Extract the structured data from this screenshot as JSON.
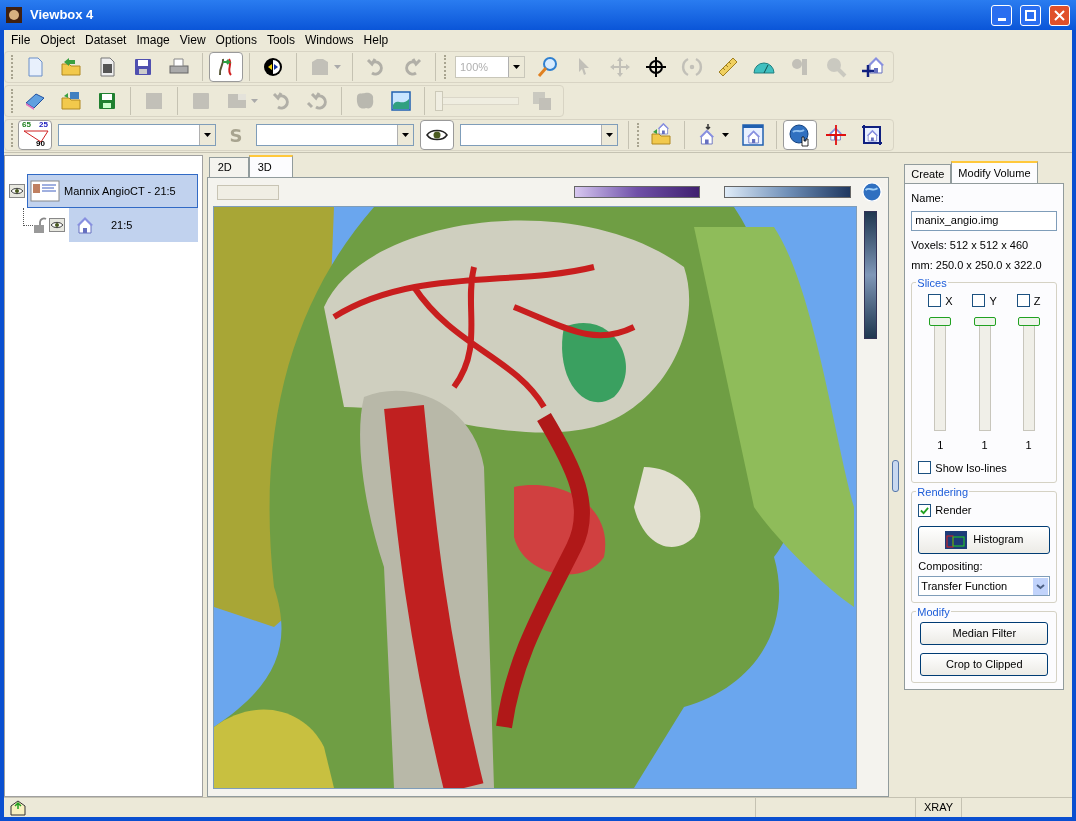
{
  "window": {
    "title": "Viewbox 4"
  },
  "menu": [
    "File",
    "Object",
    "Dataset",
    "Image",
    "View",
    "Options",
    "Tools",
    "Windows",
    "Help"
  ],
  "toolbars": [
    {
      "items": [
        {
          "kind": "grip"
        },
        {
          "kind": "button",
          "disabled": false,
          "pressed": false
        },
        {
          "kind": "button",
          "disabled": false,
          "pressed": false
        },
        {
          "kind": "button",
          "disabled": false,
          "pressed": false
        },
        {
          "kind": "button",
          "disabled": false,
          "pressed": false
        },
        {
          "kind": "button",
          "disabled": false,
          "pressed": false
        },
        {
          "kind": "separator"
        },
        {
          "kind": "button",
          "disabled": false,
          "pressed": true
        },
        {
          "kind": "separator"
        },
        {
          "kind": "button",
          "disabled": false,
          "pressed": false
        },
        {
          "kind": "separator"
        },
        {
          "kind": "dropdown_button",
          "disabled": true,
          "pressed": false
        },
        {
          "kind": "separator"
        },
        {
          "kind": "button",
          "disabled": true,
          "pressed": false
        },
        {
          "kind": "button",
          "disabled": true,
          "pressed": false
        },
        {
          "kind": "separator"
        },
        {
          "kind": "grip"
        },
        {
          "kind": "zoom_combo",
          "value": "100%",
          "disabled": true
        },
        {
          "kind": "button",
          "disabled": false,
          "pressed": false
        },
        {
          "kind": "button",
          "disabled": true,
          "pressed": false
        },
        {
          "kind": "button",
          "disabled": true,
          "pressed": false
        },
        {
          "kind": "button",
          "disabled": false,
          "pressed": false
        },
        {
          "kind": "button",
          "disabled": true,
          "pressed": false
        },
        {
          "kind": "button",
          "disabled": false,
          "pressed": false
        },
        {
          "kind": "button",
          "disabled": false,
          "pressed": false
        },
        {
          "kind": "button",
          "disabled": true,
          "pressed": false
        },
        {
          "kind": "button",
          "disabled": true,
          "pressed": false
        },
        {
          "kind": "button",
          "disabled": false,
          "pressed": false
        }
      ]
    },
    {
      "items": [
        {
          "kind": "grip"
        },
        {
          "kind": "button",
          "disabled": false,
          "pressed": false
        },
        {
          "kind": "button",
          "disabled": false,
          "pressed": false
        },
        {
          "kind": "button",
          "disabled": false,
          "pressed": false
        },
        {
          "kind": "separator"
        },
        {
          "kind": "button",
          "disabled": true,
          "pressed": false
        },
        {
          "kind": "separator"
        },
        {
          "kind": "button",
          "disabled": true,
          "pressed": false
        },
        {
          "kind": "dropdown_button",
          "disabled": true,
          "pressed": false
        },
        {
          "kind": "button",
          "disabled": true,
          "pressed": false
        },
        {
          "kind": "button",
          "disabled": true,
          "pressed": false
        },
        {
          "kind": "separator"
        },
        {
          "kind": "button",
          "disabled": true,
          "pressed": false
        },
        {
          "kind": "button",
          "disabled": false,
          "pressed": false
        },
        {
          "kind": "separator"
        },
        {
          "kind": "slider",
          "level": 0,
          "disabled": true
        },
        {
          "kind": "button",
          "disabled": true,
          "pressed": false
        }
      ]
    },
    {
      "items": [
        {
          "kind": "grip"
        },
        {
          "kind": "angle_button",
          "labels": [
            "65",
            "25",
            "90"
          ],
          "pressed": true
        },
        {
          "kind": "combo"
        },
        {
          "kind": "glyph",
          "text": "S",
          "disabled": true
        },
        {
          "kind": "combo"
        },
        {
          "kind": "button",
          "disabled": false,
          "pressed": true
        },
        {
          "kind": "combo"
        },
        {
          "kind": "separator"
        },
        {
          "kind": "grip"
        },
        {
          "kind": "button",
          "disabled": false,
          "pressed": false
        },
        {
          "kind": "separator"
        },
        {
          "kind": "dropdown_button",
          "disabled": false,
          "pressed": false
        },
        {
          "kind": "button",
          "disabled": false,
          "pressed": false
        },
        {
          "kind": "separator"
        },
        {
          "kind": "button",
          "disabled": false,
          "pressed": true
        },
        {
          "kind": "button",
          "disabled": false,
          "pressed": false
        },
        {
          "kind": "button",
          "disabled": false,
          "pressed": false
        }
      ]
    }
  ],
  "tree": [
    {
      "label": "Mannix AngioCT - 21:5",
      "visible": true,
      "selected": true,
      "children": [
        {
          "label": "21:5",
          "visible": true,
          "locked": false,
          "selected": true
        }
      ]
    }
  ],
  "view_tabs": [
    {
      "label": "2D",
      "selected": false
    },
    {
      "label": "3D",
      "selected": true
    }
  ],
  "volume_panel": {
    "tabs": [
      {
        "label": "Create",
        "selected": false
      },
      {
        "label": "Modify Volume",
        "selected": true
      }
    ],
    "name_label": "Name:",
    "name_value": "manix_angio.img",
    "voxels": "Voxels: 512 x 512 x 460",
    "mm": "mm: 250.0 x 250.0 x 322.0",
    "slices": {
      "title": "Slices",
      "axes": [
        {
          "label": "X",
          "checked": false,
          "level": 1,
          "value": "1"
        },
        {
          "label": "Y",
          "checked": false,
          "level": 1,
          "value": "1"
        },
        {
          "label": "Z",
          "checked": false,
          "level": 1,
          "value": "1"
        }
      ],
      "iso_lines": {
        "label": "Show Iso-lines",
        "checked": false
      }
    },
    "rendering": {
      "title": "Rendering",
      "render": {
        "label": "Render",
        "checked": true
      },
      "histogram_button": "Histogram",
      "compositing_label": "Compositing:",
      "compositing_value": "Transfer Function"
    },
    "modify": {
      "title": "Modify",
      "buttons": [
        "Median Filter",
        "Crop to Clipped"
      ]
    }
  },
  "status_bar": {
    "items": [
      "XRAY"
    ]
  }
}
